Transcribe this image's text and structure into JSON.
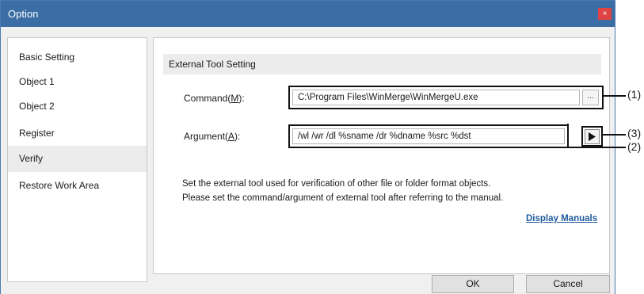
{
  "window": {
    "title": "Option",
    "close_glyph": "×"
  },
  "nav": {
    "items": [
      {
        "label": "Basic Setting"
      },
      {
        "label": "Object 1"
      },
      {
        "label": "Object 2"
      },
      {
        "label": "Register"
      },
      {
        "label": "Verify",
        "selected": true
      },
      {
        "label": "Restore Work Area"
      }
    ]
  },
  "section": {
    "title": "External Tool Setting"
  },
  "command": {
    "label_pre": "Command(",
    "label_key": "M",
    "label_post": "):",
    "value": "C:\\Program Files\\WinMerge\\WinMergeU.exe",
    "browse_label": "..."
  },
  "argument": {
    "label_pre": "Argument(",
    "label_key": "A",
    "label_post": "):",
    "value": "/wl /wr /dl %sname /dr %dname %src %dst"
  },
  "description": {
    "line1": "Set the external tool used for verification of other file or folder format objects.",
    "line2": "Please set the command/argument of external tool after referring to the manual."
  },
  "link": {
    "label": "Display Manuals"
  },
  "buttons": {
    "ok": "OK",
    "cancel": "Cancel"
  },
  "callouts": {
    "c1": "(1)",
    "c2": "(2)",
    "c3": "(3)"
  },
  "icons": {
    "arrow": "play-arrow-icon",
    "browse": "ellipsis-icon",
    "close": "close-icon"
  },
  "colors": {
    "titlebar": "#3b6ea5",
    "close": "#e04343",
    "link": "#1f5a9e",
    "selected": "#ececec"
  }
}
